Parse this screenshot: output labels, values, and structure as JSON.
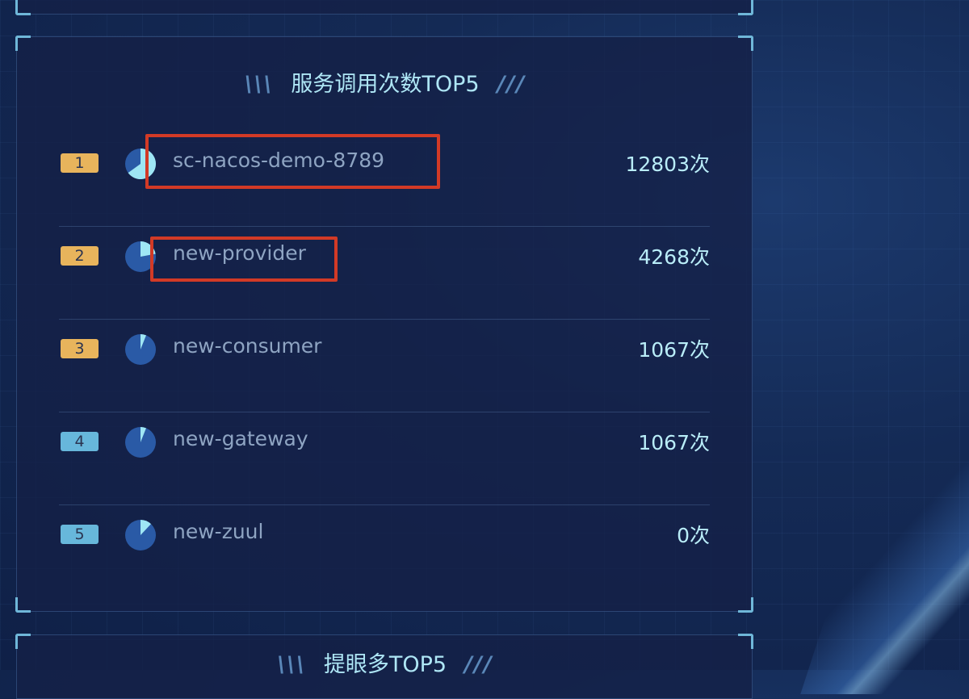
{
  "panel": {
    "title": "服务调用次数TOP5",
    "title_left_decor": "\\\\\\",
    "title_right_decor": "///"
  },
  "ranking": [
    {
      "rank": "1",
      "name": "sc-nacos-demo-8789",
      "count": "12803次",
      "badge_color": "#e8b45c",
      "share": 0.65
    },
    {
      "rank": "2",
      "name": "new-provider",
      "count": "4268次",
      "badge_color": "#e8b45c",
      "share": 0.22
    },
    {
      "rank": "3",
      "name": "new-consumer",
      "count": "1067次",
      "badge_color": "#e8b45c",
      "share": 0.06
    },
    {
      "rank": "4",
      "name": "new-gateway",
      "count": "1067次",
      "badge_color": "#67b7db",
      "share": 0.06
    },
    {
      "rank": "5",
      "name": "new-zuul",
      "count": "0次",
      "badge_color": "#67b7db",
      "share": 0.0
    }
  ],
  "bottom_panel": {
    "title_partial": "提眼多TOP5"
  },
  "colors": {
    "accent": "#aee6f5",
    "highlight_box": "#d23a26",
    "pie_fill": "#9ee6f4",
    "pie_base": "#2a5aa6"
  }
}
